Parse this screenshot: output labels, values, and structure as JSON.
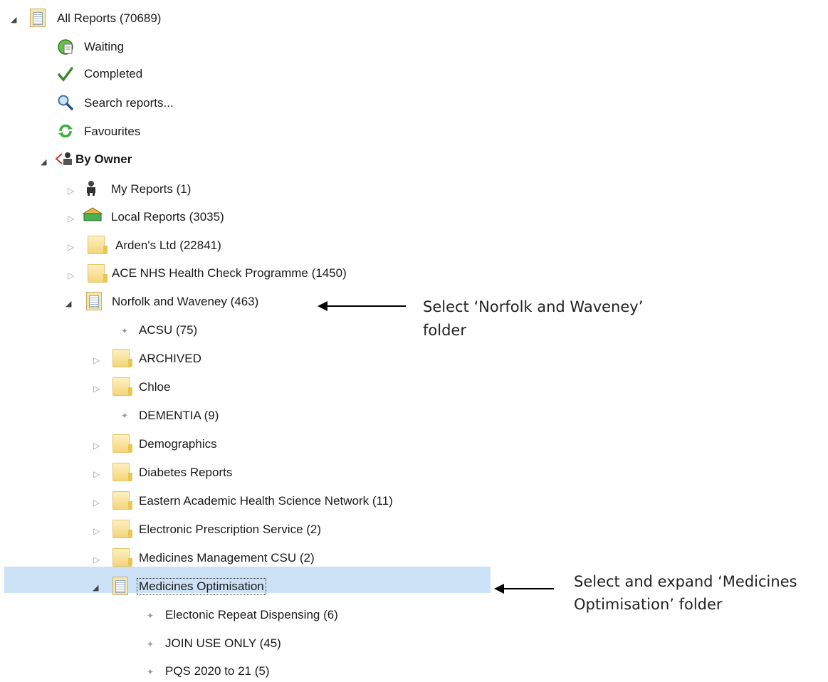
{
  "tree": {
    "root": {
      "label": "All Reports (70689)"
    },
    "waiting": {
      "label": "Waiting"
    },
    "completed": {
      "label": "Completed"
    },
    "search": {
      "label": "Search reports..."
    },
    "favourites": {
      "label": "Favourites"
    },
    "by_owner": {
      "label": "By Owner"
    },
    "owners": [
      {
        "label": "My Reports (1)"
      },
      {
        "label": "Local Reports (3035)"
      },
      {
        "label": "Arden's Ltd (22841)"
      },
      {
        "label": "ACE NHS Health Check Programme (1450)"
      },
      {
        "label": "Norfolk and Waveney (463)"
      }
    ],
    "norfolk_children": [
      {
        "label": "ACSU (75)"
      },
      {
        "label": "ARCHIVED"
      },
      {
        "label": "Chloe"
      },
      {
        "label": "DEMENTIA (9)"
      },
      {
        "label": "Demographics"
      },
      {
        "label": "Diabetes Reports"
      },
      {
        "label": "Eastern Academic Health Science Network (11)"
      },
      {
        "label": "Electronic Prescription Service (2)"
      },
      {
        "label": "Medicines Management CSU (2)"
      },
      {
        "label": "Medicines Optimisation"
      }
    ],
    "medopt_children": [
      {
        "label": "Electonic Repeat Dispensing (6)"
      },
      {
        "label": "JOIN USE ONLY (45)"
      },
      {
        "label": "PQS 2020 to 21 (5)"
      }
    ]
  },
  "annotations": {
    "note1_line1": "Select ‘Norfolk and Waveney’",
    "note1_line2": "folder",
    "note2_line1": "Select and expand ‘Medicines",
    "note2_line2": "Optimisation’ folder"
  },
  "icons": {
    "expanded": "expanded-triangle-icon",
    "collapsed": "collapsed-triangle-icon",
    "leaf": "leaf-dot-icon"
  },
  "colors": {
    "selection": "#cce1f6",
    "folder": "#f4d57a"
  }
}
